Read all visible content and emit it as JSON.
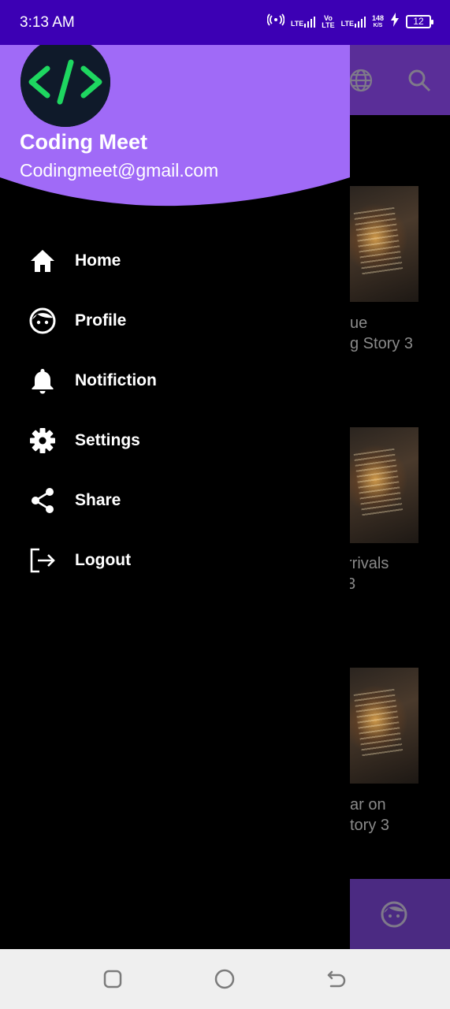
{
  "status_bar": {
    "time": "3:13 AM",
    "network1": "LTE",
    "network2_top": "Vo",
    "network2_bottom": "LTE",
    "network3": "LTE",
    "speed_value": "148",
    "speed_unit": "K/S",
    "battery": "12"
  },
  "drawer": {
    "user_name": "Coding Meet",
    "user_email": "Codingmeet@gmail.com",
    "items": [
      {
        "label": "Home",
        "icon": "home-icon"
      },
      {
        "label": "Profile",
        "icon": "face-icon"
      },
      {
        "label": "Notifiction",
        "icon": "bell-icon"
      },
      {
        "label": "Settings",
        "icon": "gear-icon"
      },
      {
        "label": "Share",
        "icon": "share-icon"
      },
      {
        "label": "Logout",
        "icon": "logout-icon"
      }
    ]
  },
  "background": {
    "cards": [
      {
        "title_line1": "ue",
        "title_line2": "g Story 3"
      },
      {
        "title_line1": "rrivals",
        "title_line2": "3"
      },
      {
        "title_line1": "ar on",
        "title_line2": "tory 3"
      }
    ]
  },
  "colors": {
    "status_bar": "#3c00b4",
    "drawer_header": "#a06af7",
    "drawer_bg": "#000000",
    "avatar_code": "#1ed760"
  }
}
